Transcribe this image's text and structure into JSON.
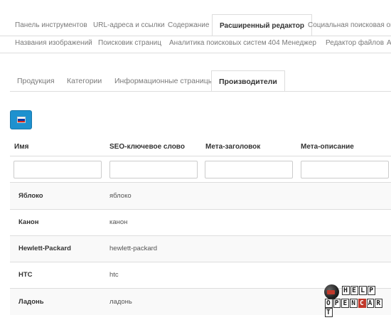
{
  "top_tabs_row1": [
    "Панель инструментов",
    "URL-адреса и ссылки",
    "Содержание",
    "Расширенный редактор",
    "Социальная поисковая оптим"
  ],
  "top_tabs_row2": [
    "Названия изображений",
    "Поисковик страниц",
    "Аналитика поисковых систем",
    "404 Менеджер",
    "Редактор файлов",
    "А"
  ],
  "sub_tabs": [
    "Продукция",
    "Категории",
    "Информационные страницы",
    "Производители"
  ],
  "language_button": {
    "flag_icon": "russian-flag-icon",
    "flag_colors": [
      "#ffffff",
      "#0039a6",
      "#d52b1e"
    ]
  },
  "table": {
    "headers": [
      "Имя",
      "SEO-ключевое слово",
      "Мета-заголовок",
      "Мета-описание"
    ],
    "filters": [
      "",
      "",
      "",
      ""
    ],
    "rows": [
      {
        "name": "Яблоко",
        "keyword": "яблоко"
      },
      {
        "name": "Канон",
        "keyword": "канон"
      },
      {
        "name": "Hewlett-Packard",
        "keyword": "hewlett-packard"
      },
      {
        "name": "HTC",
        "keyword": "htc"
      },
      {
        "name": "Ладонь",
        "keyword": "ладонь"
      }
    ]
  },
  "watermark": {
    "line1": [
      "H",
      "E",
      "L",
      "P"
    ],
    "line2": [
      "O",
      "P",
      "E",
      "N",
      "C",
      "A",
      "R",
      "T"
    ],
    "icon": "helpopencart-logo-icon"
  }
}
